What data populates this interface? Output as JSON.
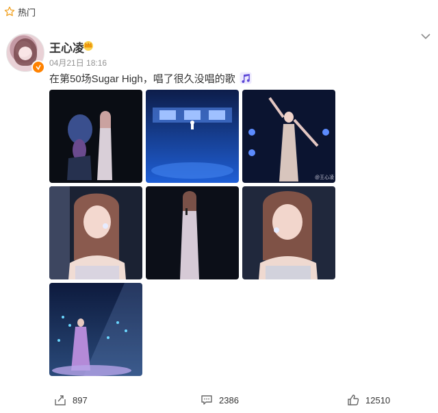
{
  "hot": {
    "label": "热门",
    "icon": "star-outline-icon"
  },
  "post": {
    "author": "王心凌",
    "time": "04月21日 18:16",
    "text": "在第50场Sugar High，唱了很久没唱的歌",
    "badges": [
      "crown-icon",
      "verified-icon"
    ],
    "music_icon": "music-note-icon",
    "image_count": 7,
    "watermark": "@王心凌"
  },
  "actions": {
    "repost": {
      "icon": "repost-icon",
      "count": "897"
    },
    "comment": {
      "icon": "comment-icon",
      "count": "2386"
    },
    "like": {
      "icon": "thumbs-up-icon",
      "count": "12510"
    }
  },
  "colors": {
    "accent": "#ff8200",
    "text": "#333333",
    "meta": "#939393",
    "stage_blue": "#1a3f9c"
  }
}
